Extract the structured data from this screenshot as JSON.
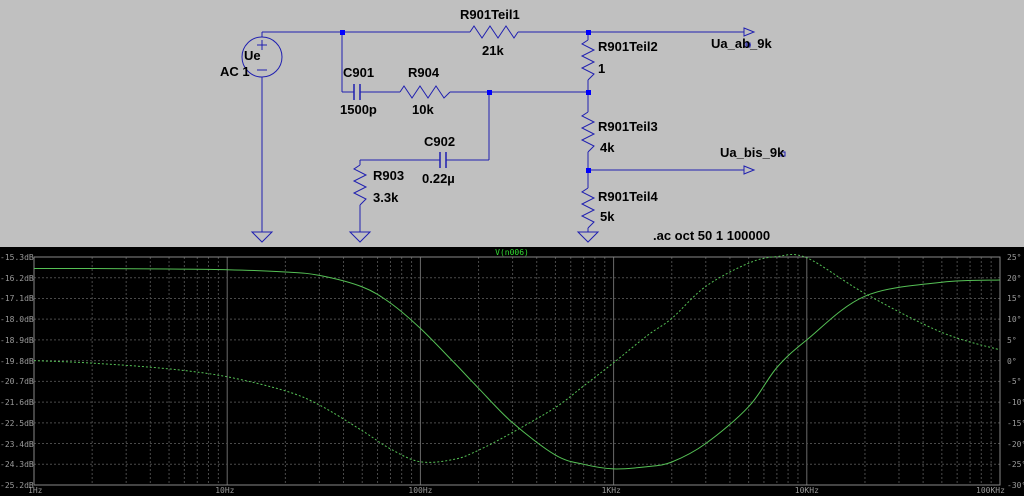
{
  "schematic": {
    "source": {
      "name": "Ue",
      "value": "AC 1"
    },
    "components": [
      {
        "id": "r901teil1",
        "name": "R901Teil1",
        "value": "21k"
      },
      {
        "id": "r901teil2",
        "name": "R901Teil2",
        "value": "1"
      },
      {
        "id": "r901teil3",
        "name": "R901Teil3",
        "value": "4k"
      },
      {
        "id": "r901teil4",
        "name": "R901Teil4",
        "value": "5k"
      },
      {
        "id": "c901",
        "name": "C901",
        "value": "1500p"
      },
      {
        "id": "r904",
        "name": "R904",
        "value": "10k"
      },
      {
        "id": "c902",
        "name": "C902",
        "value": "0.22µ"
      },
      {
        "id": "r903",
        "name": "R903",
        "value": "3.3k"
      }
    ],
    "outputs": [
      "Ua_ab_9k",
      "Ua_bis_9k"
    ],
    "directive": ".ac oct 50 1 100000"
  },
  "plot": {
    "trace_name": "V(n006)",
    "y_left_ticks": [
      "-15.3dB",
      "-16.2dB",
      "-17.1dB",
      "-18.0dB",
      "-18.9dB",
      "-19.8dB",
      "-20.7dB",
      "-21.6dB",
      "-22.5dB",
      "-23.4dB",
      "-24.3dB",
      "-25.2dB"
    ],
    "y_right_ticks": [
      "25°",
      "20°",
      "15°",
      "10°",
      "5°",
      "0°",
      "-5°",
      "-10°",
      "-15°",
      "-20°",
      "-25°",
      "-30°"
    ],
    "x_ticks": [
      "1Hz",
      "10Hz",
      "100Hz",
      "1KHz",
      "10KHz",
      "100KHz"
    ]
  },
  "chart_data": {
    "type": "line",
    "xscale": "log",
    "xlim": [
      1,
      100000
    ],
    "xlabel": "",
    "title": "V(n006)",
    "y_axes": [
      {
        "side": "left",
        "ylim": [
          -25.2,
          -15.3
        ],
        "unit": "dB"
      },
      {
        "side": "right",
        "ylim": [
          -30,
          25
        ],
        "unit": "°"
      }
    ],
    "grid": true,
    "series": [
      {
        "style": "solid",
        "color": "#55c055",
        "axis": "left",
        "x": [
          1,
          2,
          5,
          10,
          20,
          30,
          50,
          70,
          100,
          150,
          200,
          300,
          500,
          700,
          1000,
          1500,
          2000,
          3000,
          5000,
          7000,
          10000,
          20000,
          50000,
          100000
        ],
        "y": [
          -15.8,
          -15.8,
          -15.82,
          -15.85,
          -15.95,
          -16.1,
          -16.6,
          -17.3,
          -18.4,
          -19.9,
          -21.0,
          -22.5,
          -23.9,
          -24.3,
          -24.5,
          -24.4,
          -24.2,
          -23.4,
          -21.8,
          -20.1,
          -18.9,
          -17.0,
          -16.4,
          -16.3
        ]
      },
      {
        "style": "dashed",
        "color": "#55c055",
        "axis": "right",
        "x": [
          1,
          2,
          5,
          10,
          20,
          30,
          50,
          70,
          100,
          150,
          200,
          300,
          500,
          700,
          1000,
          1500,
          2000,
          3000,
          5000,
          7000,
          10000,
          20000,
          50000,
          100000
        ],
        "y": [
          0.0,
          -0.6,
          -2.0,
          -3.9,
          -7.3,
          -10.7,
          -16.9,
          -21.3,
          -24.4,
          -23.8,
          -21.6,
          -17.3,
          -11.3,
          -6.1,
          -0.5,
          6.1,
          10.2,
          17.9,
          23.5,
          25.1,
          24.8,
          16.2,
          6.8,
          2.6
        ]
      }
    ]
  },
  "colors": {
    "wire": "#1f1fb0",
    "node": "#0000ff",
    "trace": "#55c055",
    "grid": "#555555",
    "plot_bg": "#000000",
    "schem_bg": "#c0c0c0"
  }
}
